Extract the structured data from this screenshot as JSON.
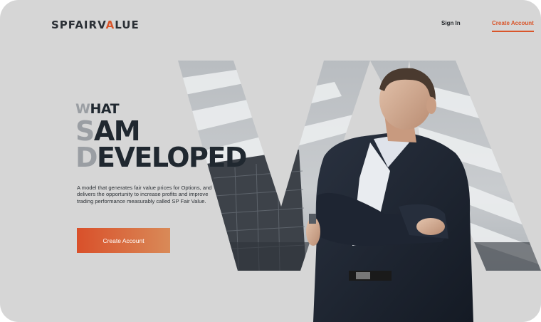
{
  "header": {
    "logo_part1": "SPFAIRV",
    "logo_accent": "A",
    "logo_part2": "LUE",
    "sign_in": "Sign In",
    "create_account": "Create Account"
  },
  "hero": {
    "line1_initial": "W",
    "line1_rest": "HAT",
    "line2_initial": "S",
    "line2_rest": "AM",
    "line3_initial": "D",
    "line3_rest": "EVELOPED",
    "description": "A model that generates fair value prices for Options, and delivers the opportunity to increase profits and improve trading performance measurably called SP Fair Value.",
    "cta_label": "Create Account"
  },
  "colors": {
    "background": "#d6d6d6",
    "accent": "#d9552a",
    "headline": "#202830",
    "initials": "#9a9ea3"
  }
}
